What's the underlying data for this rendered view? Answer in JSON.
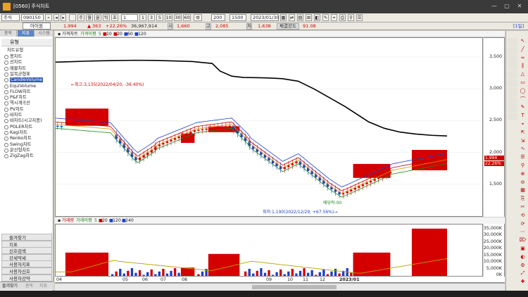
{
  "window": {
    "title": "[0560] 주식차트",
    "controls": [
      "—",
      "▢",
      "✕"
    ]
  },
  "toolbar": {
    "market": "주식",
    "code": "090150",
    "periods": [
      "주",
      "월",
      "분",
      "틱",
      "초"
    ],
    "minutes": [
      "1",
      "3",
      "5",
      "10",
      "30",
      "60"
    ],
    "count1": "200",
    "count2": "1500",
    "date": "2023/01/30",
    "help": "[1일]",
    "stock_name": "아이원",
    "price": "1,994",
    "change": "363",
    "change_pct": "+22.26%",
    "volume": "36,967,914",
    "open_label": "시",
    "open": "1,660",
    "high_label": "고",
    "high": "2,085",
    "low_label": "저",
    "low": "1,638",
    "strength_label": "체결강도",
    "strength": "91.08"
  },
  "left_panel": {
    "tabs": [
      "종목",
      "지표",
      "시스템"
    ],
    "active_tab": "지표",
    "section_title": "유형",
    "group_label": "차트유형",
    "chart_types": [
      "봉차트",
      "선차트",
      "매물차트",
      "일목균형표",
      "CandleVolume",
      "EquiVolume",
      "FLOW차트",
      "P&F차트",
      "역시계곡선",
      "PV차트",
      "바차트",
      "바차트(시고저종)",
      "POLER차트",
      "Kagi차트",
      "Renko차트",
      "Swing차트",
      "분산형차트",
      "ZigZag차트"
    ],
    "selected_type": "CandleVolume",
    "bottom_groups": [
      "즐겨찾기",
      "지표",
      "신호검색",
      "강세약세",
      "사용자지표",
      "사용자신호",
      "사용자강약"
    ],
    "footer_tabs": [
      "즐겨찾기",
      "종목",
      "지표"
    ]
  },
  "chart": {
    "legend_price": [
      "가격차트",
      "가격이평",
      "5",
      "10",
      "20",
      "60",
      "120"
    ],
    "legend_volume": [
      "거래량",
      "거래이평",
      "5",
      "20",
      "120",
      "240"
    ],
    "annotation_high": "←최고:3,135(2022/04/20, -36.40%)",
    "annotation_low": "최저:1,190(2022/12/29, +67.56%)→",
    "annotation_mark": "배당락:00",
    "price_tag": "1,994",
    "price_tag2": "22.26%"
  },
  "chart_data": {
    "type": "candlevolume",
    "price_axis": [
      3500,
      3000,
      2500,
      2000,
      1500
    ],
    "price_axis_labels": [
      "3,500",
      "3,000",
      "2,500",
      "2,000",
      "1,500"
    ],
    "volume_axis_labels": [
      "35,000K",
      "30,000K",
      "25,000K",
      "20,000K",
      "15,000K",
      "10,000K",
      "5,000K",
      "0K"
    ],
    "volume_axis": [
      35000,
      30000,
      25000,
      20000,
      15000,
      10000,
      5000,
      0
    ],
    "x_ticks": [
      "04",
      "05",
      "06",
      "07",
      "08",
      "09",
      "10",
      "11",
      "12",
      "2023/01"
    ],
    "ma120": [
      [
        0,
        3420
      ],
      [
        5,
        3430
      ],
      [
        10,
        3440
      ],
      [
        15,
        3445
      ],
      [
        20,
        3450
      ],
      [
        25,
        3448
      ],
      [
        30,
        3440
      ],
      [
        35,
        3430
      ],
      [
        40,
        3400
      ],
      [
        42,
        3280
      ],
      [
        45,
        3200
      ],
      [
        48,
        3180
      ],
      [
        52,
        3175
      ],
      [
        55,
        3170
      ],
      [
        58,
        3160
      ],
      [
        62,
        3120
      ],
      [
        66,
        3000
      ],
      [
        70,
        2860
      ],
      [
        74,
        2720
      ],
      [
        77,
        2600
      ],
      [
        80,
        2480
      ],
      [
        84,
        2380
      ],
      [
        88,
        2320
      ],
      [
        92,
        2290
      ],
      [
        96,
        2270
      ],
      [
        100,
        2260
      ]
    ],
    "high": 3135,
    "low": 1190,
    "last_close": 1994
  },
  "colors": {
    "up": "#d40000",
    "down": "#1c3fc8",
    "ma120": "#000000"
  }
}
